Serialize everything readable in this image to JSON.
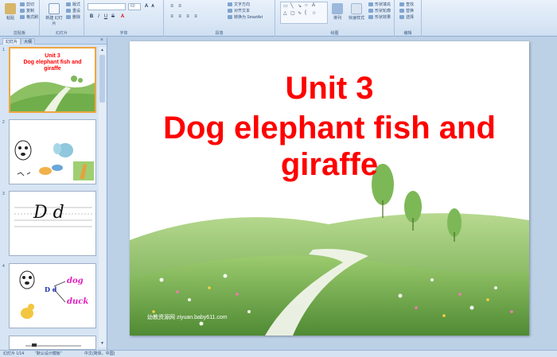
{
  "ribbon": {
    "clipboard": {
      "paste": "粘贴",
      "cut": "剪切",
      "copy": "复制",
      "format_painter": "格式刷",
      "label": "剪贴板"
    },
    "slides": {
      "new_slide": "新建\n幻灯片",
      "layout": "版式",
      "reset": "重设",
      "delete": "删除",
      "label": "幻灯片"
    },
    "font": {
      "font_name": "",
      "font_size": "60",
      "label": "字体"
    },
    "paragraph": {
      "text_direction": "文字方向",
      "align_text": "对齐文本",
      "smartart": "转换为 SmartArt",
      "label": "段落"
    },
    "drawing": {
      "arrange": "排列",
      "quick_styles": "快速样式",
      "shape_fill": "形状填充",
      "shape_outline": "形状轮廓",
      "shape_effects": "形状效果",
      "label": "绘图"
    },
    "editing": {
      "find": "查找",
      "replace": "替换",
      "select": "选择",
      "label": "编辑"
    }
  },
  "pane": {
    "tab_slides": "幻灯片",
    "tab_outline": "大纲",
    "thumbs": [
      {
        "num": "1",
        "line1": "Unit 3",
        "line2": "Dog elephant fish and",
        "line3": "giraffe"
      },
      {
        "num": "2"
      },
      {
        "num": "3",
        "letters": "D d"
      },
      {
        "num": "4",
        "big": "D d",
        "word1": "dog",
        "word2": "duck"
      }
    ]
  },
  "slide": {
    "title_line1": "Unit 3",
    "title_line2": "Dog elephant fish and",
    "title_line3": "giraffe",
    "watermark": "幼教资源网 ziyuan.baby611.com"
  },
  "status": {
    "slide_count": "幻灯片 1/14",
    "theme": "\"默认设计模板\"",
    "language": "中文(简体，中国)"
  },
  "colors": {
    "title": "#ff0000",
    "accent": "#f0a641"
  }
}
